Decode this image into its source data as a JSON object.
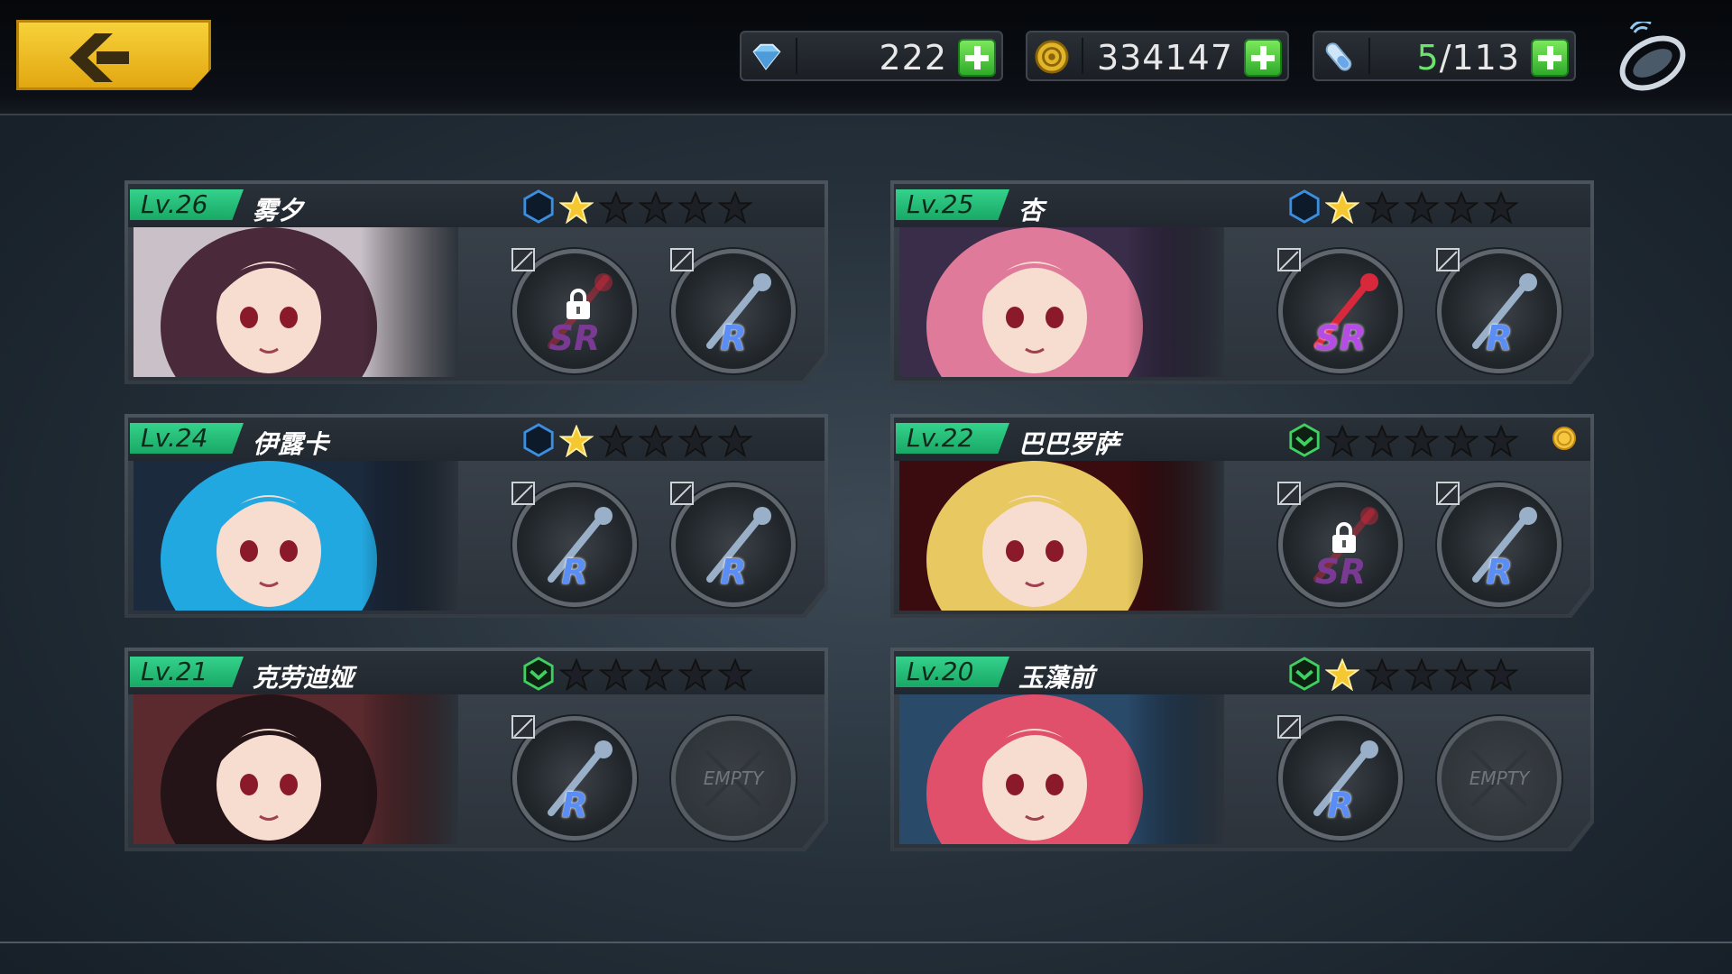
{
  "resources": [
    {
      "icon": "gem-icon",
      "value": "222"
    },
    {
      "icon": "coin-icon",
      "value": "334147"
    },
    {
      "icon": "potion-icon",
      "current": "5",
      "max": "/113"
    }
  ],
  "characters": [
    {
      "level": "Lv.26",
      "name": "雾夕",
      "class_color": "#3a8fe0",
      "stars": 1,
      "hair": "#4a2a3a",
      "bg": "#c9c0c8",
      "slots": [
        {
          "rarity": "SR",
          "locked": true,
          "empty": false
        },
        {
          "rarity": "R",
          "locked": false,
          "empty": false
        }
      ]
    },
    {
      "level": "Lv.25",
      "name": "杏",
      "class_color": "#3a8fe0",
      "stars": 1,
      "hair": "#e07a9a",
      "bg": "#3a2d4a",
      "slots": [
        {
          "rarity": "SR",
          "locked": false,
          "empty": false
        },
        {
          "rarity": "R",
          "locked": false,
          "empty": false
        }
      ]
    },
    {
      "level": "Lv.24",
      "name": "伊露卡",
      "class_color": "#3a8fe0",
      "stars": 1,
      "hair": "#22a8e0",
      "bg": "#1c2a3e",
      "slots": [
        {
          "rarity": "R",
          "locked": false,
          "empty": false
        },
        {
          "rarity": "R",
          "locked": false,
          "empty": false
        }
      ]
    },
    {
      "level": "Lv.22",
      "name": "巴巴罗萨",
      "class_color": "#3ed060",
      "stars": 0,
      "hair": "#e8c860",
      "bg": "#3a0c10",
      "medal": true,
      "slots": [
        {
          "rarity": "SR",
          "locked": true,
          "empty": false
        },
        {
          "rarity": "R",
          "locked": false,
          "empty": false
        }
      ]
    },
    {
      "level": "Lv.21",
      "name": "克劳迪娅",
      "class_color": "#3ed060",
      "stars": 0,
      "hair": "#241418",
      "bg": "#5a2a2e",
      "slots": [
        {
          "rarity": "R",
          "locked": false,
          "empty": false
        },
        {
          "empty": true,
          "label": "EMPTY"
        }
      ]
    },
    {
      "level": "Lv.20",
      "name": "玉藻前",
      "class_color": "#3ed060",
      "stars": 1,
      "hair": "#e0506a",
      "bg": "#2a4a6a",
      "slots": [
        {
          "rarity": "R",
          "locked": false,
          "empty": false
        },
        {
          "empty": true,
          "label": "EMPTY"
        }
      ]
    }
  ]
}
